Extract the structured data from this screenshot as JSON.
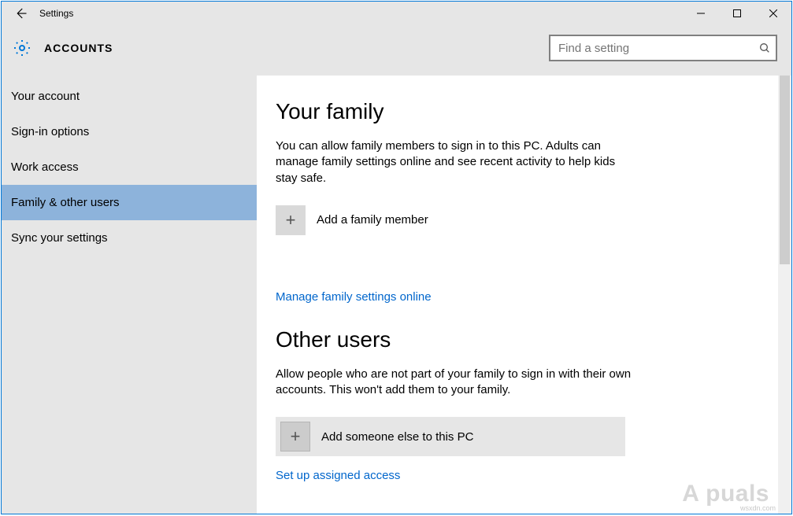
{
  "window": {
    "title": "Settings"
  },
  "header": {
    "crumb": "ACCOUNTS"
  },
  "search": {
    "placeholder": "Find a setting"
  },
  "sidebar": {
    "items": [
      {
        "label": "Your account"
      },
      {
        "label": "Sign-in options"
      },
      {
        "label": "Work access"
      },
      {
        "label": "Family & other users"
      },
      {
        "label": "Sync your settings"
      }
    ],
    "selected_index": 3
  },
  "main": {
    "family": {
      "heading": "Your family",
      "desc": "You can allow family members to sign in to this PC. Adults can manage family settings online and see recent activity to help kids stay safe.",
      "add_label": "Add a family member",
      "manage_link": "Manage family settings online"
    },
    "other": {
      "heading": "Other users",
      "desc": "Allow people who are not part of your family to sign in with their own accounts. This won't add them to your family.",
      "add_label": "Add someone else to this PC",
      "assigned_link": "Set up assigned access"
    }
  },
  "watermark": {
    "text": "A  puals",
    "src": "wsxdn.com"
  }
}
